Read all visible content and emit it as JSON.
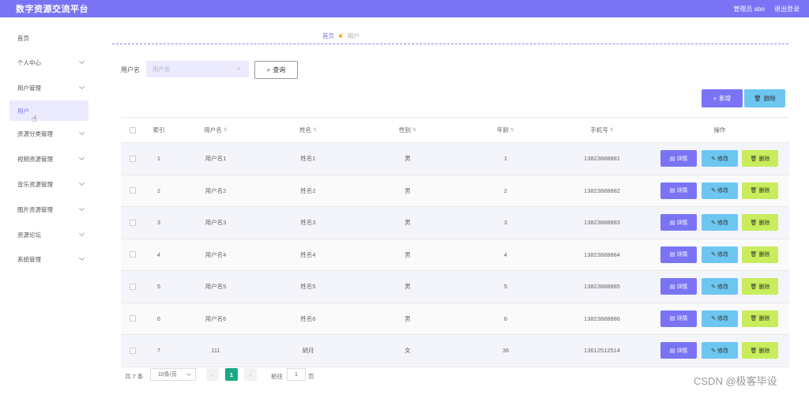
{
  "app": {
    "title": "数字资源交流平台",
    "admin_label": "管理员 abo",
    "logout_label": "退出登录"
  },
  "sidebar": {
    "items": [
      {
        "label": "首页",
        "has_arrow": false,
        "active": false
      },
      {
        "label": "个人中心",
        "has_arrow": true,
        "active": false
      },
      {
        "label": "用户管理",
        "has_arrow": true,
        "active": false
      },
      {
        "label": "用户",
        "has_arrow": false,
        "active": true
      },
      {
        "label": "资源分类管理",
        "has_arrow": true,
        "active": false
      },
      {
        "label": "视频资源管理",
        "has_arrow": true,
        "active": false
      },
      {
        "label": "音乐资源管理",
        "has_arrow": true,
        "active": false
      },
      {
        "label": "图片资源管理",
        "has_arrow": true,
        "active": false
      },
      {
        "label": "资源论坛",
        "has_arrow": true,
        "active": false
      },
      {
        "label": "系统管理",
        "has_arrow": true,
        "active": false
      }
    ]
  },
  "breadcrumb": {
    "home": "首页",
    "current": "用户"
  },
  "search": {
    "label": "用户名",
    "placeholder": "用户名",
    "button": "查询"
  },
  "toolbar": {
    "add": "新增",
    "delete": "删除"
  },
  "table": {
    "headers": {
      "index": "索引",
      "username": "用户名",
      "name": "姓名",
      "gender": "性别",
      "age": "年龄",
      "phone": "手机号",
      "actions": "操作"
    },
    "rows": [
      {
        "index": "1",
        "username": "用户名1",
        "name": "姓名1",
        "gender": "男",
        "age": "1",
        "phone": "13823888881"
      },
      {
        "index": "2",
        "username": "用户名2",
        "name": "姓名2",
        "gender": "男",
        "age": "2",
        "phone": "13823888882"
      },
      {
        "index": "3",
        "username": "用户名3",
        "name": "姓名3",
        "gender": "男",
        "age": "3",
        "phone": "13823888883"
      },
      {
        "index": "4",
        "username": "用户名4",
        "name": "姓名4",
        "gender": "男",
        "age": "4",
        "phone": "13823888884"
      },
      {
        "index": "5",
        "username": "用户名5",
        "name": "姓名5",
        "gender": "男",
        "age": "5",
        "phone": "13823888885"
      },
      {
        "index": "6",
        "username": "用户名6",
        "name": "姓名6",
        "gender": "男",
        "age": "6",
        "phone": "13823888886"
      },
      {
        "index": "7",
        "username": "111",
        "name": "胡月",
        "gender": "女",
        "age": "36",
        "phone": "13612512514"
      }
    ],
    "actions": {
      "detail": "详情",
      "edit": "修改",
      "delete": "删除"
    }
  },
  "pager": {
    "total": "共 7 条",
    "page_size": "10条/页",
    "current": "1",
    "goto": "前往",
    "goto_value": "1",
    "page_unit": "页"
  },
  "watermark": "CSDN @极客毕设",
  "colors": {
    "primary": "#7a74f5",
    "info": "#6cc6f0",
    "lime": "#c8ec5b",
    "pager_active": "#1ba784"
  }
}
